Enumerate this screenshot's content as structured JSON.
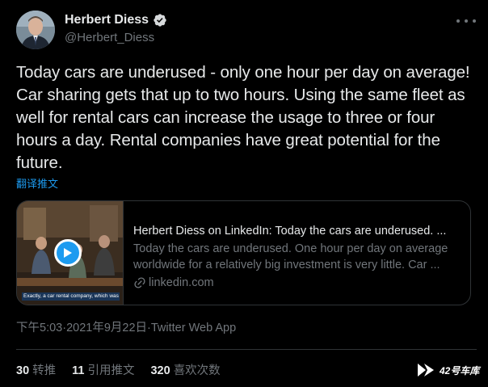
{
  "author": {
    "name": "Herbert Diess",
    "handle": "@Herbert_Diess"
  },
  "tweet": {
    "text": "Today cars are underused - only one hour per day on average! Car sharing gets that up to two hours. Using the same fleet as well for rental cars can increase the usage to three or four hours a day. Rental companies have great potential for the future.",
    "translate_label": "翻译推文"
  },
  "link_card": {
    "title": "Herbert Diess on LinkedIn: Today the cars are underused. ...",
    "description_line1": "Today the cars are underused. One hour per day on average",
    "description_line2": "worldwide for a relatively big investment is very little. Car ...",
    "domain": "linkedin.com",
    "thumbnail_caption": "Exactly, a car rental company, which was down"
  },
  "meta": {
    "time": "下午5:03",
    "separator1": " · ",
    "date": "2021年9月22日",
    "separator2": " · ",
    "source": "Twitter Web App"
  },
  "stats": [
    {
      "count": "30",
      "label": "转推"
    },
    {
      "count": "11",
      "label": "引用推文"
    },
    {
      "count": "320",
      "label": "喜欢次数"
    }
  ],
  "watermark": {
    "text": "42号车库"
  },
  "colors": {
    "background": "#000000",
    "primary_text": "#e7e9ea",
    "secondary_text": "#71767b",
    "accent": "#1d9bf0",
    "border": "#2f3336"
  },
  "icons": {
    "verified": "verified-badge-icon",
    "more": "more-horizontal-icon",
    "play": "play-icon",
    "link": "link-icon",
    "watermark_logo": "garage42-logo-icon"
  }
}
